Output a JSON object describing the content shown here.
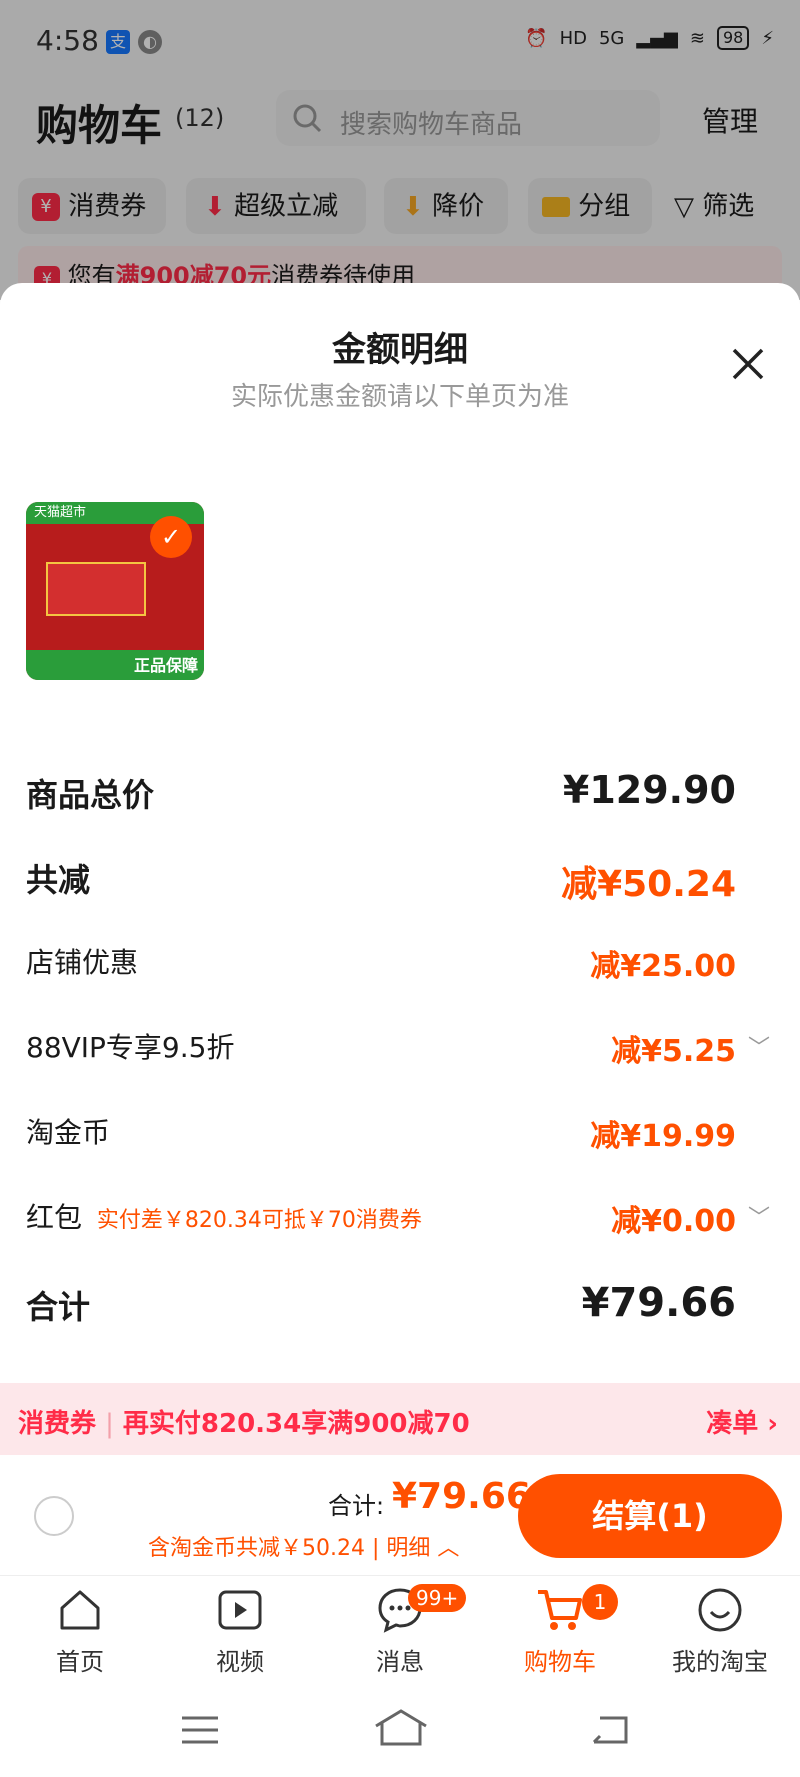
{
  "status_bar": {
    "time": "4:58",
    "network": "5G",
    "battery": "98"
  },
  "header": {
    "title": "购物车",
    "count": "(12)",
    "search_placeholder": "搜索购物车商品",
    "manage": "管理"
  },
  "filter_chips": [
    {
      "icon": "coupon-icon",
      "label": "消费券"
    },
    {
      "icon": "arrow-down-icon",
      "label": "超级立减"
    },
    {
      "icon": "price-drop-icon",
      "label": "降价"
    },
    {
      "icon": "folder-icon",
      "label": "分组"
    },
    {
      "icon": "filter-icon",
      "label": "筛选"
    }
  ],
  "coupon_notice": {
    "prefix": "您有",
    "highlight": "满900减70元",
    "suffix": "消费券待使用"
  },
  "sheet": {
    "title": "金额明细",
    "subtitle": "实际优惠金额请以下单页为准",
    "product_banner_text": "天猫超市",
    "product_badge_text": "正品保障"
  },
  "breakdown": {
    "total_price_label": "商品总价",
    "total_price": "¥129.90",
    "total_discount_label": "共减",
    "total_discount": "减¥50.24",
    "items": [
      {
        "label": "店铺优惠",
        "value": "减¥25.00",
        "expand": false
      },
      {
        "label": "88VIP专享9.5折",
        "value": "减¥5.25",
        "expand": true
      },
      {
        "label": "淘金币",
        "value": "减¥19.99",
        "expand": false
      },
      {
        "label": "红包",
        "note": "实付差￥820.34可抵￥70消费券",
        "value": "减¥0.00",
        "expand": true
      }
    ],
    "sum_label": "合计",
    "sum_value": "¥79.66"
  },
  "coupon_banner": {
    "left": "消费券",
    "divider": "|",
    "text": "再实付820.34享满900减70",
    "action": "凑单"
  },
  "checkout": {
    "total_label": "合计:",
    "total_value": "¥79.66",
    "coin_note": "含淘金币共减￥50.24 | 明细",
    "button": "结算(1)"
  },
  "tabs": [
    {
      "label": "首页",
      "icon": "home-icon"
    },
    {
      "label": "视频",
      "icon": "video-icon"
    },
    {
      "label": "消息",
      "icon": "message-icon",
      "badge": "99+"
    },
    {
      "label": "购物车",
      "icon": "cart-icon",
      "badge": "1",
      "active": true
    },
    {
      "label": "我的淘宝",
      "icon": "profile-icon"
    }
  ],
  "colors": {
    "accent": "#ff5000",
    "coupon_red": "#ff2c48"
  }
}
